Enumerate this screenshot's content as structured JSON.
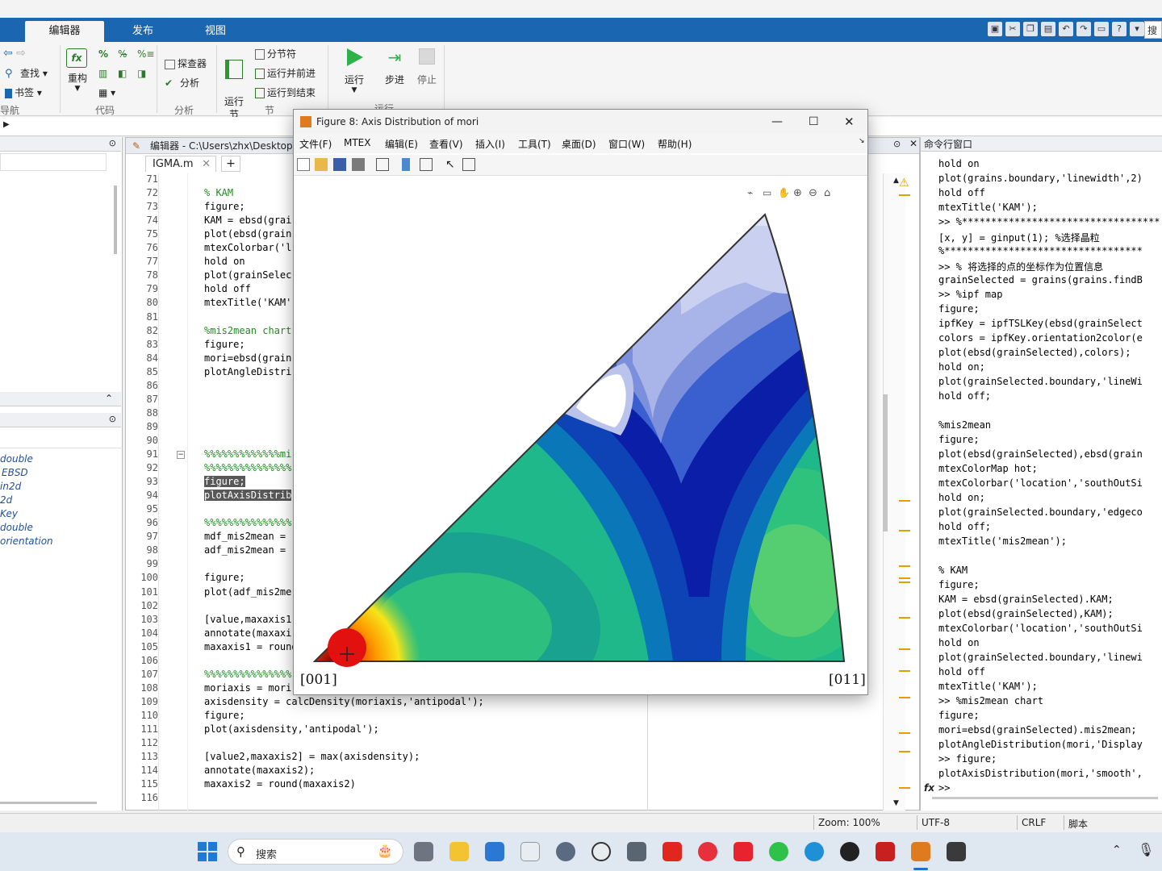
{
  "ribbon_tabs": [
    "编辑器",
    "发布",
    "视图"
  ],
  "search_label": "搜索",
  "ribbon": {
    "find": "查找",
    "bookmark": "书签",
    "nav_group": "导航",
    "refactor": "重构",
    "code_group": "代码",
    "inspector": "探查器",
    "analyze": "分析",
    "analyze_group": "分析",
    "run_section": "运行\n节",
    "section_break": "分节符",
    "run_advance": "运行并前进",
    "run_to_end": "运行到结束",
    "section_group": "节",
    "run": "运行",
    "step": "步进",
    "stop": "停止",
    "run_group": "运行"
  },
  "workspace_items": [
    "double",
    "EBSD",
    "in2d",
    "2d",
    "Key",
    "double",
    "orientation"
  ],
  "editor": {
    "title": "编辑器 - C:\\Users\\zhx\\Desktop\\",
    "tab": "IGMA.m",
    "lines": [
      {
        "n": "71",
        "t": ""
      },
      {
        "n": "72",
        "t": "% KAM",
        "c": "cmt"
      },
      {
        "n": "73",
        "t": "figure;"
      },
      {
        "n": "74",
        "t": "KAM = ebsd(grai"
      },
      {
        "n": "75",
        "t": "plot(ebsd(grain"
      },
      {
        "n": "76",
        "t": "mtexColorbar('l"
      },
      {
        "n": "77",
        "t": "hold on"
      },
      {
        "n": "78",
        "t": "plot(grainSelec"
      },
      {
        "n": "79",
        "t": "hold off"
      },
      {
        "n": "80",
        "t": "mtexTitle('KAM'"
      },
      {
        "n": "81",
        "t": ""
      },
      {
        "n": "82",
        "t": "%mis2mean chart",
        "c": "cmt"
      },
      {
        "n": "83",
        "t": "figure;"
      },
      {
        "n": "84",
        "t": "mori=ebsd(grain"
      },
      {
        "n": "85",
        "t": "plotAngleDistri"
      },
      {
        "n": "86",
        "t": ""
      },
      {
        "n": "87",
        "t": ""
      },
      {
        "n": "88",
        "t": ""
      },
      {
        "n": "89",
        "t": ""
      },
      {
        "n": "90",
        "t": ""
      },
      {
        "n": "91",
        "t": "%%%%%%%%%%%%%mi",
        "c": "cmt"
      },
      {
        "n": "92",
        "t": "%%%%%%%%%%%%%%%",
        "c": "cmt"
      },
      {
        "n": "93",
        "t": "figure;",
        "c": "hl"
      },
      {
        "n": "94",
        "t": "plotAxisDistrib",
        "c": "hl"
      },
      {
        "n": "95",
        "t": ""
      },
      {
        "n": "96",
        "t": "%%%%%%%%%%%%%%%",
        "c": "cmt"
      },
      {
        "n": "97",
        "t": "mdf_mis2mean ="
      },
      {
        "n": "98",
        "t": "adf_mis2mean ="
      },
      {
        "n": "99",
        "t": ""
      },
      {
        "n": "100",
        "t": "figure;"
      },
      {
        "n": "101",
        "t": "plot(adf_mis2me"
      },
      {
        "n": "102",
        "t": ""
      },
      {
        "n": "103",
        "t": "[value,maxaxis1"
      },
      {
        "n": "104",
        "t": "annotate(maxaxi"
      },
      {
        "n": "105",
        "t": "maxaxis1 = round"
      },
      {
        "n": "106",
        "t": ""
      },
      {
        "n": "107",
        "t": "%%%%%%%%%%%%%%%",
        "c": "cmt"
      },
      {
        "n": "108",
        "t": "moriaxis = mori"
      },
      {
        "n": "109",
        "t": "axisdensity = calcDensity(moriaxis,'antipodal');"
      },
      {
        "n": "110",
        "t": "figure;"
      },
      {
        "n": "111",
        "t": "plot(axisdensity,'antipodal');"
      },
      {
        "n": "112",
        "t": ""
      },
      {
        "n": "113",
        "t": "[value2,maxaxis2] = max(axisdensity);"
      },
      {
        "n": "114",
        "t": "annotate(maxaxis2);"
      },
      {
        "n": "115",
        "t": "maxaxis2 = round(maxaxis2)"
      },
      {
        "n": "116",
        "t": ""
      }
    ]
  },
  "command_window": {
    "title": "命令行窗口",
    "lines": [
      "hold on",
      "plot(grains.boundary,'linewidth',2)",
      "hold off",
      "mtexTitle('KAM');",
      ">> %**********************************",
      "[x, y] = ginput(1); %选择晶粒",
      "%**********************************",
      ">> % 将选择的点的坐标作为位置信息",
      "grainSelected = grains(grains.findB",
      ">> %ipf map",
      "figure;",
      "ipfKey = ipfTSLKey(ebsd(grainSelect",
      "colors = ipfKey.orientation2color(e",
      "plot(ebsd(grainSelected),colors);",
      "hold on;",
      "plot(grainSelected.boundary,'lineWi",
      "hold off;",
      "",
      "%mis2mean",
      "figure;",
      "plot(ebsd(grainSelected),ebsd(grain",
      "mtexColorMap hot;",
      "mtexColorbar('location','southOutSi",
      "hold on;",
      "plot(grainSelected.boundary,'edgeco",
      "hold off;",
      "mtexTitle('mis2mean');",
      "",
      "% KAM",
      "figure;",
      "KAM = ebsd(grainSelected).KAM;",
      "plot(ebsd(grainSelected),KAM);",
      "mtexColorbar('location','southOutSi",
      "hold on",
      "plot(grainSelected.boundary,'linewi",
      "hold off",
      "mtexTitle('KAM');",
      ">> %mis2mean chart",
      "figure;",
      "mori=ebsd(grainSelected).mis2mean;",
      "plotAngleDistribution(mori,'Display",
      ">> figure;",
      "plotAxisDistribution(mori,'smooth',",
      ">>"
    ]
  },
  "status": {
    "zoom": "Zoom: 100%",
    "encoding": "UTF-8",
    "eol": "CRLF",
    "mode": "脚本"
  },
  "taskbar": {
    "search": "搜索"
  },
  "figure": {
    "title": "Figure 8: Axis Distribution of mori",
    "menu": [
      "文件(F)",
      "MTEX",
      "编辑(E)",
      "查看(V)",
      "插入(I)",
      "工具(T)",
      "桌面(D)",
      "窗口(W)",
      "帮助(H)"
    ],
    "corner_left": "[001]",
    "corner_right": "[011]"
  }
}
